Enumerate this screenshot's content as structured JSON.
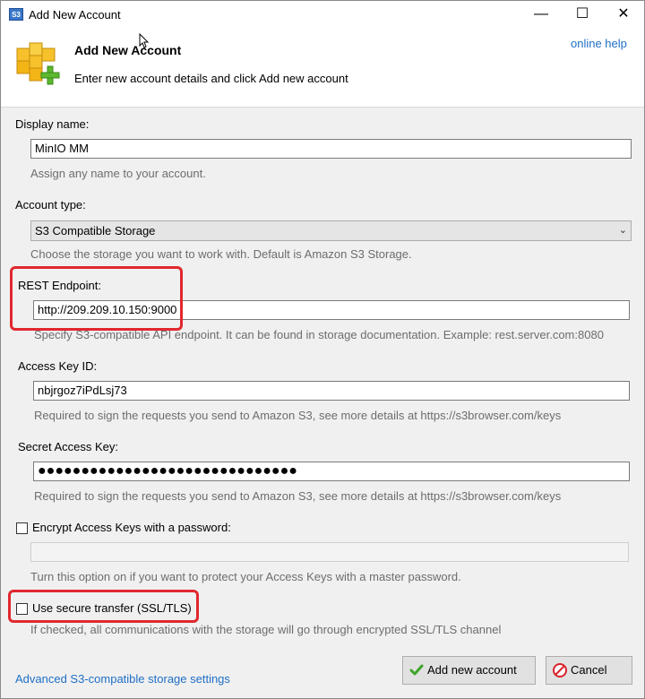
{
  "window": {
    "title": "Add New Account",
    "icon_text": "S3",
    "minimize": "—",
    "maximize": "☐",
    "close": "✕"
  },
  "header": {
    "title": "Add New Account",
    "description": "Enter new account details and click Add new account",
    "help_link": "online help"
  },
  "display_name": {
    "label": "Display name:",
    "value": "MinIO MM",
    "hint": "Assign any name to your account."
  },
  "account_type": {
    "label": "Account type:",
    "value": "S3 Compatible Storage",
    "hint": "Choose the storage you want to work with. Default is Amazon S3 Storage."
  },
  "rest_endpoint": {
    "label": "REST Endpoint:",
    "value": "http://209.209.10.150:9000",
    "hint": "Specify S3-compatible API endpoint. It can be found in storage documentation. Example: rest.server.com:8080"
  },
  "access_key": {
    "label": "Access Key ID:",
    "value": "nbjrgoz7iPdLsj73",
    "hint": "Required to sign the requests you send to Amazon S3, see more details at https://s3browser.com/keys"
  },
  "secret_key": {
    "label": "Secret Access Key:",
    "value": "●●●●●●●●●●●●●●●●●●●●●●●●●●●●●●",
    "hint": "Required to sign the requests you send to Amazon S3, see more details at https://s3browser.com/keys"
  },
  "encrypt": {
    "label": "Encrypt Access Keys with a password:",
    "value": "",
    "checked": false,
    "hint": "Turn this option on if you want to protect your Access Keys with a master password."
  },
  "secure_transfer": {
    "label": "Use secure transfer (SSL/TLS)",
    "checked": false,
    "hint": "If checked, all communications with the storage will go through encrypted SSL/TLS channel"
  },
  "footer": {
    "advanced_link": "Advanced S3-compatible storage settings",
    "add_button": "Add new account",
    "cancel_button": "Cancel"
  },
  "colors": {
    "highlight": "#e0282e",
    "link": "#1f6fc5",
    "hint": "#6d6d6d"
  }
}
